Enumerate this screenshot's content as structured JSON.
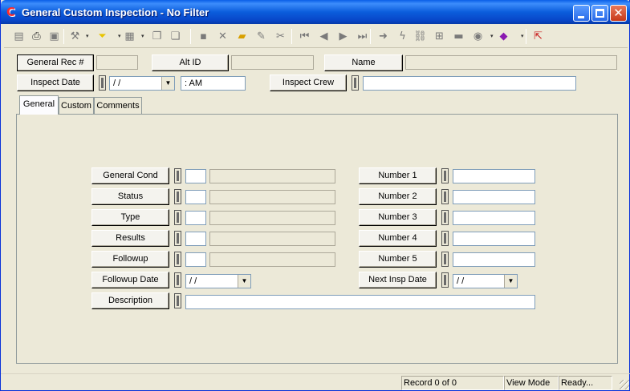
{
  "window": {
    "title": "General Custom Inspection - No Filter",
    "app_icon": "C",
    "controls": {
      "minimize": "_",
      "maximize": "□",
      "close": "✕"
    }
  },
  "toolbar": {
    "icons": [
      {
        "name": "grid-view-icon",
        "glyph": "▤",
        "active": false
      },
      {
        "name": "print-icon",
        "glyph": "⎙",
        "active": true
      },
      {
        "name": "print-preview-icon",
        "glyph": "▣",
        "active": false
      },
      {
        "name": "tools-icon",
        "glyph": "⚒",
        "active": false
      },
      {
        "name": "filter-icon",
        "glyph": "⏷",
        "active": true,
        "color": "#e8c400"
      },
      {
        "name": "report-icon",
        "glyph": "▦",
        "active": false
      },
      {
        "name": "copy-record-icon",
        "glyph": "❐",
        "active": false
      },
      {
        "name": "paste-record-icon",
        "glyph": "❏",
        "active": false
      },
      {
        "name": "save-icon",
        "glyph": "▪",
        "active": false
      },
      {
        "name": "delete-icon",
        "glyph": "✕",
        "active": false
      },
      {
        "name": "add-record-icon",
        "glyph": "▰",
        "active": true,
        "color": "#d8a000"
      },
      {
        "name": "edit-icon",
        "glyph": "✎",
        "active": false
      },
      {
        "name": "cut-icon",
        "glyph": "✂",
        "active": false
      },
      {
        "name": "first-record-icon",
        "glyph": "⏮",
        "active": false
      },
      {
        "name": "previous-record-icon",
        "glyph": "◀",
        "active": false
      },
      {
        "name": "next-record-icon",
        "glyph": "▶",
        "active": false
      },
      {
        "name": "last-record-icon",
        "glyph": "⏭",
        "active": false
      },
      {
        "name": "goto-icon",
        "glyph": "➜",
        "active": false
      },
      {
        "name": "lightning-icon",
        "glyph": "ϟ",
        "active": false
      },
      {
        "name": "link-icon",
        "glyph": "⛓",
        "active": false
      },
      {
        "name": "tree-icon",
        "glyph": "⊞",
        "active": false
      },
      {
        "name": "calculator-icon",
        "glyph": "▬",
        "active": false
      },
      {
        "name": "zoom-icon",
        "glyph": "◉",
        "active": false
      },
      {
        "name": "book-icon",
        "glyph": "◆",
        "active": true,
        "color": "#8a1ab0"
      },
      {
        "name": "exit-icon",
        "glyph": "⇱",
        "active": true,
        "color": "#c81a1a"
      }
    ]
  },
  "header": {
    "general_rec_label": "General Rec #",
    "general_rec_value": "",
    "alt_id_label": "Alt ID",
    "alt_id_value": "",
    "name_label": "Name",
    "name_value": "",
    "inspect_date_label": "Inspect Date",
    "inspect_date_value": " /  /",
    "inspect_time_value": " :  AM",
    "inspect_crew_label": "Inspect Crew",
    "inspect_crew_value": ""
  },
  "tabs": [
    {
      "label": "General",
      "active": true
    },
    {
      "label": "Custom",
      "active": false
    },
    {
      "label": "Comments",
      "active": false
    }
  ],
  "general": {
    "general_cond_label": "General Cond",
    "status_label": "Status",
    "type_label": "Type",
    "results_label": "Results",
    "followup_label": "Followup",
    "followup_date_label": "Followup Date",
    "followup_date_value": " /  /",
    "description_label": "Description",
    "description_value": "",
    "number1_label": "Number 1",
    "number2_label": "Number 2",
    "number3_label": "Number 3",
    "number4_label": "Number 4",
    "number5_label": "Number 5",
    "next_insp_date_label": "Next Insp Date",
    "next_insp_date_value": " /  /"
  },
  "status": {
    "record": "Record 0 of 0",
    "mode": "View Mode",
    "state": "Ready..."
  }
}
